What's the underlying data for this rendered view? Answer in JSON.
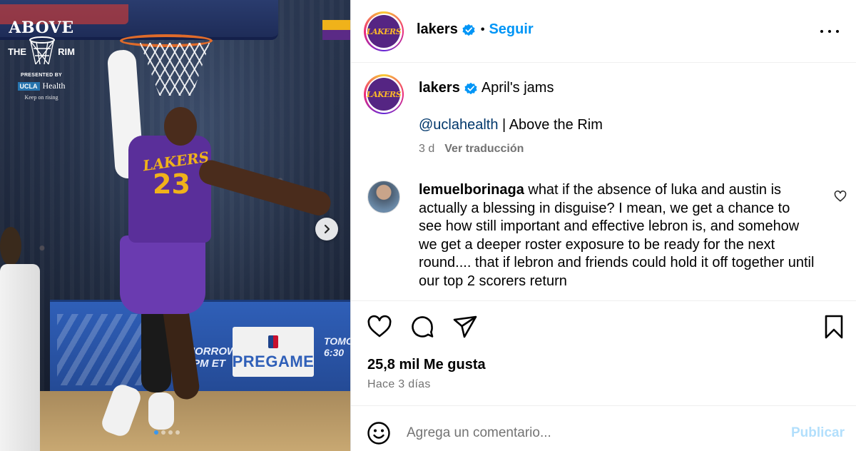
{
  "media": {
    "brand": {
      "title": "ABOVE",
      "the": "THE",
      "rim": "RIM",
      "presented": "PRESENTED BY",
      "ucla": "UCLA",
      "health": "Health",
      "tagline": "Keep on rising"
    },
    "jersey_text": "LAKERS",
    "jersey_number": "23",
    "sign_pregame": "PREGAME",
    "sign_tomorrow": "TOMORROW 6:30PM ET",
    "sign_tomorrow_partial": "TOMO 6:30",
    "carousel": {
      "current": 1,
      "total": 4
    }
  },
  "header": {
    "username": "lakers",
    "separator": "•",
    "follow_label": "Seguir"
  },
  "caption": {
    "username": "lakers",
    "text": "April's jams",
    "mention": "@uclahealth",
    "line2_rest": " | Above the Rim",
    "time": "3 d",
    "translate": "Ver traducción"
  },
  "comment": {
    "username": "lemuelborinaga",
    "text": " what if the absence of luka and austin is actually a blessing in disguise? I mean, we get a chance to see how still important and effective lebron is, and somehow we get a deeper roster exposure to be ready for the next round.... that if lebron and friends could hold it off together until our top 2 scorers return"
  },
  "stats": {
    "likes": "25,8 mil Me gusta",
    "time_ago": "Hace 3 días"
  },
  "composer": {
    "placeholder": "Agrega un comentario...",
    "publish_label": "Publicar"
  },
  "icons": {
    "like": "heart-icon",
    "comment": "comment-icon",
    "share": "share-icon",
    "save": "bookmark-icon",
    "more": "more-icon",
    "emoji": "emoji-icon",
    "next": "chevron-right-icon",
    "verified": "verified-badge-icon"
  },
  "colors": {
    "accent": "#0095f6",
    "mention": "#00376b",
    "muted": "#737373",
    "publish_disabled": "#b2dffc",
    "lakers_purple": "#552583",
    "lakers_gold": "#fdb927"
  }
}
